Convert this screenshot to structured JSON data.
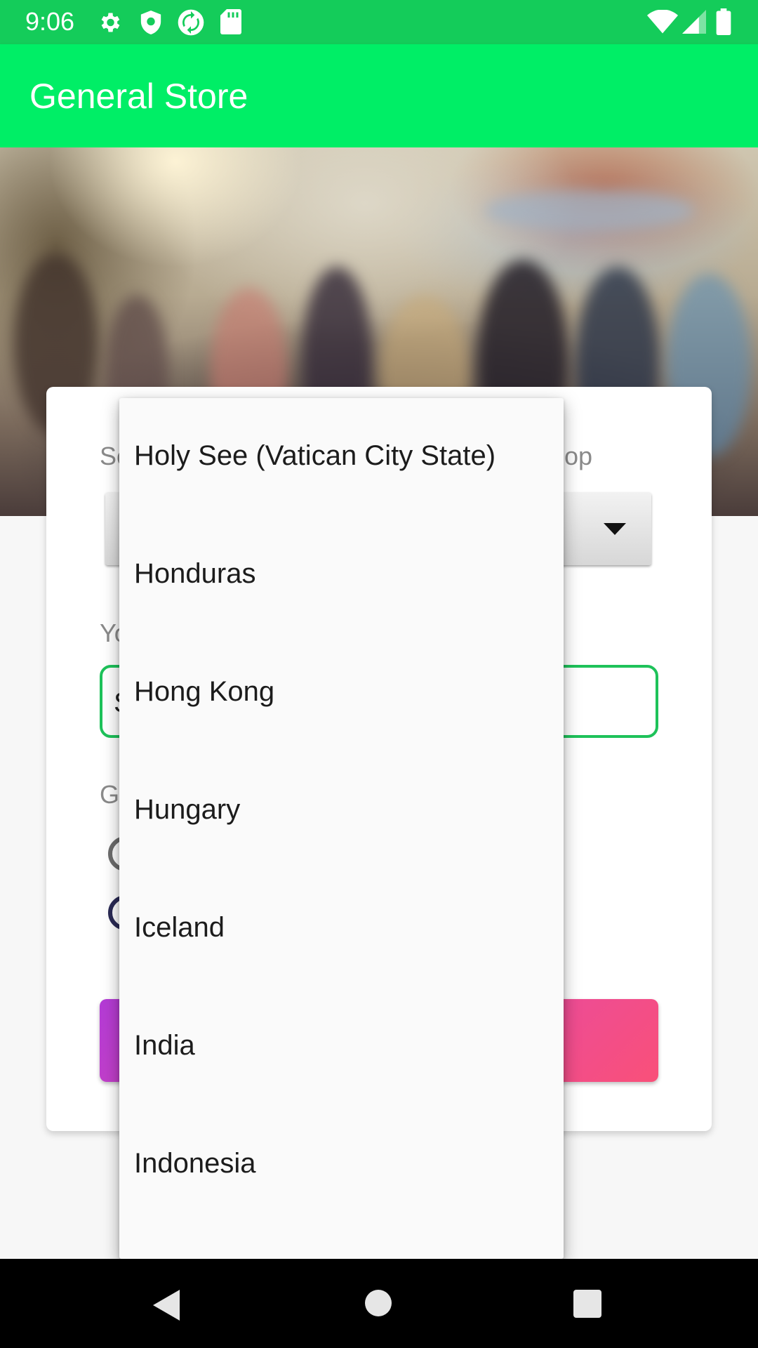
{
  "status_bar": {
    "time": "9:06",
    "left_icons": [
      "settings-icon",
      "shield-icon",
      "sync-icon",
      "sd-card-icon"
    ],
    "right_icons": [
      "wifi-icon",
      "signal-icon",
      "battery-icon"
    ]
  },
  "app_bar": {
    "title": "General Store"
  },
  "form": {
    "country_label_partial_left": "Se",
    "country_label_partial_right": "op",
    "name_label_partial": "Yo",
    "name_value_partial": "S",
    "gender_label_partial": "Ge"
  },
  "dropdown": {
    "items": [
      "Holy See (Vatican City State)",
      "Honduras",
      "Hong Kong",
      "Hungary",
      "Iceland",
      "India",
      "Indonesia"
    ]
  },
  "colors": {
    "status_bar": "#14cc5a",
    "app_bar": "#00ee66",
    "field_border": "#1ec25a",
    "button_gradient_start": "#b33bd6",
    "button_gradient_end": "#f95079"
  },
  "nav_bar": {
    "icons": [
      "back-icon",
      "home-icon",
      "recents-icon"
    ]
  }
}
